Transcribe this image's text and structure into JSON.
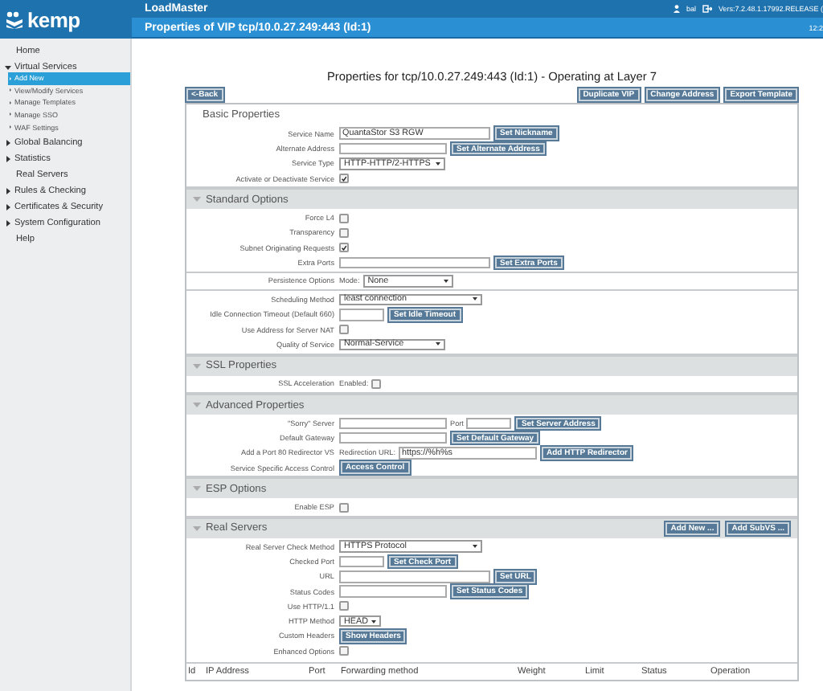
{
  "header": {
    "logo": "kemp",
    "app_title": "LoadMaster",
    "page_title": "Properties of VIP tcp/10.0.27.249:443 (Id:1)",
    "user": "bal",
    "version": "Vers:7.2.48.1.17992.RELEASE (",
    "clock": "12:2"
  },
  "sidebar": {
    "items": [
      {
        "label": "Home",
        "selected": false
      },
      {
        "label": "Virtual Services",
        "selected": false,
        "expanded": true,
        "children": [
          {
            "label": "Add New",
            "selected": true
          },
          {
            "label": "View/Modify Services",
            "selected": false
          },
          {
            "label": "Manage Templates",
            "selected": false
          },
          {
            "label": "Manage SSO",
            "selected": false
          },
          {
            "label": "WAF Settings",
            "selected": false
          }
        ]
      },
      {
        "label": "Global Balancing",
        "selected": false,
        "expanded": false
      },
      {
        "label": "Statistics",
        "selected": false,
        "expanded": false
      },
      {
        "label": "Real Servers",
        "selected": false
      },
      {
        "label": "Rules & Checking",
        "selected": false,
        "expanded": false
      },
      {
        "label": "Certificates & Security",
        "selected": false,
        "expanded": false
      },
      {
        "label": "System Configuration",
        "selected": false,
        "expanded": false
      },
      {
        "label": "Help",
        "selected": false
      }
    ]
  },
  "heading": "Properties for tcp/10.0.27.249:443 (Id:1) - Operating at Layer 7",
  "back_button": "<-Back",
  "actions": [
    "Duplicate VIP",
    "Change Address",
    "Export Template"
  ],
  "sections": [
    {
      "title": "Basic Properties",
      "kind": "plain",
      "groups": [
        [
          {
            "label": "Service Name",
            "controls": [
              {
                "kind": "field_l",
                "value": "QuantaStor S3 RGW"
              },
              {
                "kind": "button",
                "label": "Set Nickname"
              }
            ]
          },
          {
            "label": "Alternate Address",
            "controls": [
              {
                "kind": "field_m"
              },
              {
                "kind": "button",
                "label": "Set Alternate Address"
              }
            ]
          },
          {
            "label": "Service Type",
            "controls": [
              {
                "kind": "select_m",
                "value": "HTTP-HTTP/2-HTTPS"
              }
            ]
          },
          {
            "label": "Activate or Deactivate Service",
            "controls": [
              {
                "kind": "checkbox",
                "checked": true
              }
            ]
          }
        ]
      ]
    },
    {
      "title": "Standard Options",
      "kind": "band",
      "expanded": true,
      "groups": [
        [
          {
            "label": "Force L4",
            "controls": [
              {
                "kind": "checkbox",
                "checked": false
              }
            ]
          },
          {
            "label": "Transparency",
            "controls": [
              {
                "kind": "checkbox",
                "checked": false
              }
            ]
          },
          {
            "label": "Subnet Originating Requests",
            "controls": [
              {
                "kind": "checkbox",
                "checked": true
              }
            ]
          },
          {
            "label": "Extra Ports",
            "controls": [
              {
                "kind": "field_l"
              },
              {
                "kind": "button",
                "label": "Set Extra Ports"
              }
            ]
          }
        ],
        [
          {
            "label": "Persistence Options",
            "controls": [
              {
                "kind": "text",
                "text": "Mode:"
              },
              {
                "kind": "select_p",
                "value": "None"
              }
            ]
          }
        ],
        [
          {
            "label": "Scheduling Method",
            "controls": [
              {
                "kind": "select_l",
                "value": "least connection"
              }
            ]
          },
          {
            "label": "Idle Connection Timeout (Default 660)",
            "controls": [
              {
                "kind": "field_s"
              },
              {
                "kind": "button",
                "label": "Set Idle Timeout"
              }
            ]
          },
          {
            "label": "Use Address for Server NAT",
            "controls": [
              {
                "kind": "checkbox",
                "checked": false
              }
            ]
          },
          {
            "label": "Quality of Service",
            "controls": [
              {
                "kind": "select_m",
                "value": "Normal-Service"
              }
            ]
          }
        ]
      ]
    },
    {
      "title": "SSL Properties",
      "kind": "band",
      "expanded": true,
      "groups": [
        [
          {
            "label": "SSL Acceleration",
            "controls": [
              {
                "kind": "text",
                "text": "Enabled:"
              },
              {
                "kind": "checkbox",
                "checked": false
              }
            ]
          }
        ]
      ]
    },
    {
      "title": "Advanced Properties",
      "kind": "band",
      "expanded": true,
      "groups": [
        [
          {
            "label": "\"Sorry\" Server",
            "controls": [
              {
                "kind": "field_m"
              },
              {
                "kind": "text",
                "text": "Port"
              },
              {
                "kind": "field_s"
              },
              {
                "kind": "button",
                "label": "Set Server Address"
              }
            ]
          },
          {
            "label": "Default Gateway",
            "controls": [
              {
                "kind": "field_m"
              },
              {
                "kind": "button",
                "label": "Set Default Gateway"
              }
            ]
          },
          {
            "label": "Add a Port 80 Redirector VS",
            "controls": [
              {
                "kind": "text",
                "text": "Redirection URL:"
              },
              {
                "kind": "field_r",
                "value": "https://%h%s"
              },
              {
                "kind": "button",
                "label": "Add HTTP Redirector"
              }
            ]
          },
          {
            "label": "Service Specific Access Control",
            "controls": [
              {
                "kind": "button",
                "label": "Access Control"
              }
            ]
          }
        ]
      ]
    },
    {
      "title": "ESP Options",
      "kind": "band",
      "expanded": true,
      "groups": [
        [
          {
            "label": "Enable ESP",
            "controls": [
              {
                "kind": "checkbox",
                "checked": false
              }
            ]
          }
        ]
      ]
    },
    {
      "title": "Real Servers",
      "kind": "band",
      "expanded": true,
      "buttons": [
        "Add New ...",
        "Add SubVS ..."
      ],
      "groups": [
        [
          {
            "label": "Real Server Check Method",
            "controls": [
              {
                "kind": "select_l",
                "value": "HTTPS Protocol"
              }
            ]
          },
          {
            "label": "Checked Port",
            "controls": [
              {
                "kind": "field_s"
              },
              {
                "kind": "button",
                "label": "Set Check Port"
              }
            ]
          },
          {
            "label": "URL",
            "controls": [
              {
                "kind": "field_l"
              },
              {
                "kind": "button",
                "label": "Set URL"
              }
            ]
          },
          {
            "label": "Status Codes",
            "controls": [
              {
                "kind": "field_m"
              },
              {
                "kind": "button",
                "label": "Set Status Codes"
              }
            ]
          },
          {
            "label": "Use HTTP/1.1",
            "controls": [
              {
                "kind": "checkbox",
                "checked": false
              }
            ]
          },
          {
            "label": "HTTP Method",
            "controls": [
              {
                "kind": "select_s",
                "value": "HEAD"
              }
            ]
          },
          {
            "label": "Custom Headers",
            "controls": [
              {
                "kind": "button",
                "label": "Show Headers"
              }
            ]
          },
          {
            "label": "Enhanced Options",
            "controls": [
              {
                "kind": "checkbox",
                "checked": false
              }
            ]
          }
        ]
      ],
      "table": {
        "columns": [
          "Id",
          "IP Address",
          "Port",
          "Forwarding method",
          "Weight",
          "Limit",
          "Status",
          "Operation"
        ]
      }
    }
  ]
}
